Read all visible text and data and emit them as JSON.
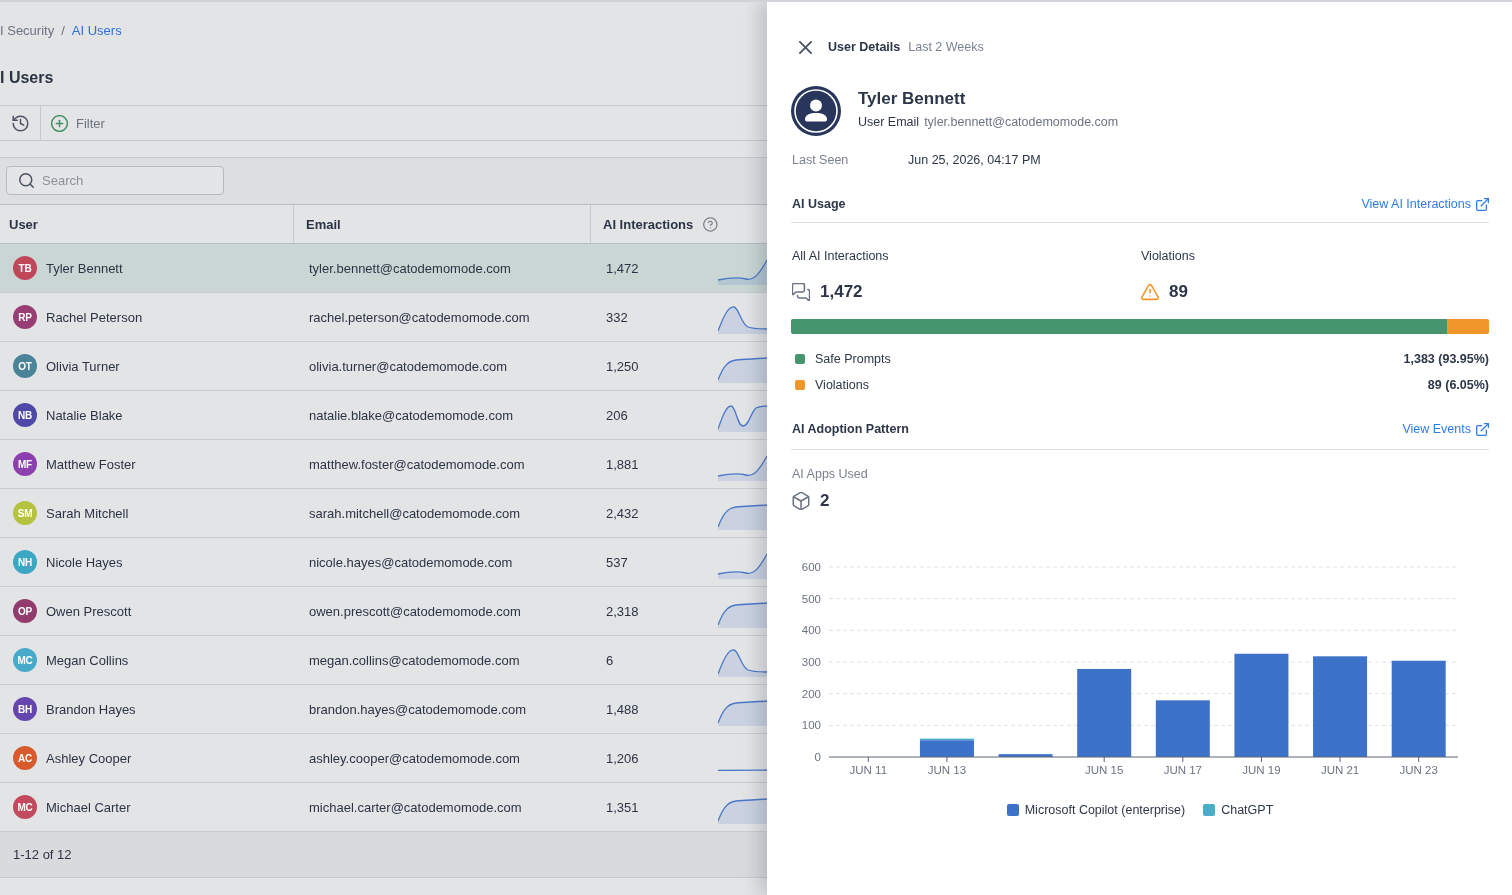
{
  "breadcrumb": {
    "items": [
      "I Security",
      "AI Users"
    ],
    "separator": "/"
  },
  "page_title": "I Users",
  "toolbar": {
    "filter": "Filter"
  },
  "search": {
    "placeholder": "Search"
  },
  "table": {
    "columns": [
      "User",
      "Email",
      "AI Interactions"
    ],
    "rows": [
      {
        "initials": "TB",
        "name": "Tyler Bennett",
        "color": "#c0465a",
        "email": "tyler.bennett@catodemomode.com",
        "interactions": "1,472",
        "selected": true
      },
      {
        "initials": "RP",
        "name": "Rachel Peterson",
        "color": "#983e74",
        "email": "rachel.peterson@catodemomode.com",
        "interactions": "332",
        "selected": false
      },
      {
        "initials": "OT",
        "name": "Olivia Turner",
        "color": "#4b8499",
        "email": "olivia.turner@catodemomode.com",
        "interactions": "1,250",
        "selected": false
      },
      {
        "initials": "NB",
        "name": "Natalie Blake",
        "color": "#4f48a8",
        "email": "natalie.blake@catodemomode.com",
        "interactions": "206",
        "selected": false
      },
      {
        "initials": "MF",
        "name": "Matthew Foster",
        "color": "#8c3fae",
        "email": "matthew.foster@catodemomode.com",
        "interactions": "1,881",
        "selected": false
      },
      {
        "initials": "SM",
        "name": "Sarah Mitchell",
        "color": "#b5c23f",
        "email": "sarah.mitchell@catodemomode.com",
        "interactions": "2,432",
        "selected": false
      },
      {
        "initials": "NH",
        "name": "Nicole Hayes",
        "color": "#3ba7c2",
        "email": "nicole.hayes@catodemomode.com",
        "interactions": "537",
        "selected": false
      },
      {
        "initials": "OP",
        "name": "Owen Prescott",
        "color": "#923c6d",
        "email": "owen.prescott@catodemomode.com",
        "interactions": "2,318",
        "selected": false
      },
      {
        "initials": "MC",
        "name": "Megan Collins",
        "color": "#48aac9",
        "email": "megan.collins@catodemomode.com",
        "interactions": "6",
        "selected": false
      },
      {
        "initials": "BH",
        "name": "Brandon Hayes",
        "color": "#6546ae",
        "email": "brandon.hayes@catodemomode.com",
        "interactions": "1,488",
        "selected": false
      },
      {
        "initials": "AC",
        "name": "Ashley Cooper",
        "color": "#d65a2c",
        "email": "ashley.cooper@catodemomode.com",
        "interactions": "1,206",
        "selected": false
      },
      {
        "initials": "MC",
        "name": "Michael Carter",
        "color": "#c24a5e",
        "email": "michael.carter@catodemomode.com",
        "interactions": "1,351",
        "selected": false
      }
    ]
  },
  "pagination": "1-12 of 12",
  "details": {
    "title": "User Details",
    "period": "Last 2 Weeks",
    "user": {
      "name": "Tyler Bennett",
      "email_label": "User Email",
      "email": "tyler.bennett@catodemomode.com"
    },
    "last_seen": {
      "label": "Last Seen",
      "value": "Jun 25, 2026, 04:17 PM"
    },
    "ai_usage": {
      "title": "AI Usage",
      "link": "View AI Interactions",
      "stats": [
        {
          "kind": "interactions",
          "label": "All AI Interactions",
          "value": "1,472"
        },
        {
          "kind": "violations",
          "label": "Violations",
          "value": "89"
        }
      ],
      "breakdown": [
        {
          "label": "Safe Prompts",
          "value": "1,383 (93.95%)",
          "color": "#45966f",
          "level": 0.9395
        },
        {
          "label": "Violations",
          "value": "89 (6.05%)",
          "color": "#f0962a",
          "level": 0.0605
        }
      ]
    },
    "adoption": {
      "title": "AI Adoption Pattern",
      "link": "View Events",
      "apps_label": "AI Apps Used",
      "apps_count": "2",
      "chart_data": {
        "type": "bar",
        "stacked": true,
        "grid": "y",
        "legend": "bottom",
        "categories": [
          "JUN 11",
          "JUN 13",
          null,
          "JUN 15",
          "JUN 17",
          "JUN 19",
          "JUN 21",
          "JUN 23"
        ],
        "ylim": [
          0,
          600
        ],
        "yticks": [
          0,
          100,
          200,
          300,
          400,
          500,
          600
        ],
        "series": [
          {
            "name": "Microsoft Copilot (enterprise)",
            "color": "#3d72c9",
            "values": [
              0,
              53,
              9,
              278,
              179,
              326,
              318,
              304
            ]
          },
          {
            "name": "ChatGPT",
            "color": "#4aaec8",
            "values": [
              0,
              5,
              0,
              0,
              0,
              0,
              0,
              0
            ]
          }
        ]
      }
    }
  }
}
